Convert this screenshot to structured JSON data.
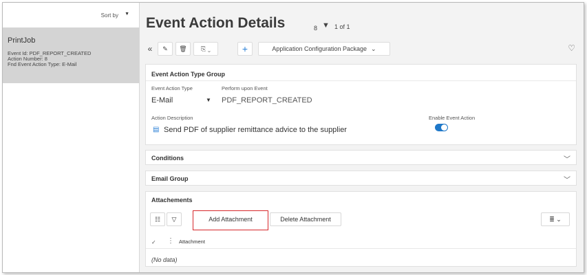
{
  "sidebar": {
    "sort_label": "Sort by",
    "record": {
      "title": "PrintJob",
      "event_id": "Event Id:  PDF_REPORT_CREATED",
      "action_number": "Action Number:  8",
      "action_type": "Fnd Event Action Type:  E-Mail"
    }
  },
  "header": {
    "title": "Event Action Details",
    "count": "8",
    "paging": "1 of 1"
  },
  "toolbar": {
    "package_label": "Application Configuration Package"
  },
  "type_group": {
    "heading": "Event Action Type Group",
    "event_action_type_label": "Event Action Type",
    "event_action_type_value": "E-Mail",
    "perform_upon_label": "Perform upon Event",
    "perform_upon_value": "PDF_REPORT_CREATED",
    "action_description_label": "Action Description",
    "action_description_value": "Send PDF of supplier remittance advice to the supplier",
    "enable_label": "Enable Event Action",
    "enabled": true
  },
  "conditions": {
    "heading": "Conditions"
  },
  "email_group": {
    "heading": "Email Group"
  },
  "attachments": {
    "heading": "Attachements",
    "add_label": "Add Attachment",
    "delete_label": "Delete Attachment",
    "column_header": "Attachment",
    "empty_text": "(No data)"
  },
  "colors": {
    "accent": "#1f78c9",
    "highlight": "#d6262a"
  }
}
